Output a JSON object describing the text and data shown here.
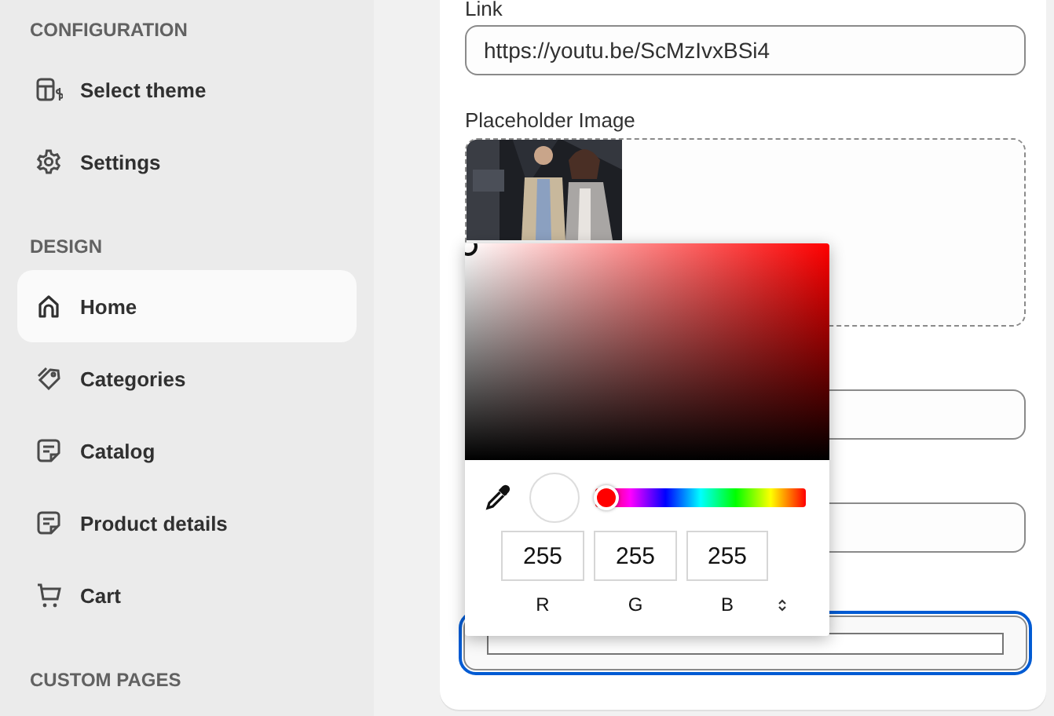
{
  "sidebar": {
    "sections": [
      {
        "title": "CONFIGURATION",
        "items": [
          {
            "label": "Select theme",
            "kind": "theme",
            "selected": false
          },
          {
            "label": "Settings",
            "kind": "gear",
            "selected": false
          }
        ]
      },
      {
        "title": "DESIGN",
        "items": [
          {
            "label": "Home",
            "kind": "home",
            "selected": true
          },
          {
            "label": "Categories",
            "kind": "tag",
            "selected": false
          },
          {
            "label": "Catalog",
            "kind": "note",
            "selected": false
          },
          {
            "label": "Product details",
            "kind": "note",
            "selected": false
          },
          {
            "label": "Cart",
            "kind": "cart",
            "selected": false
          }
        ]
      },
      {
        "title": "CUSTOM PAGES"
      }
    ]
  },
  "form": {
    "fields": [
      {
        "kind": "text",
        "label": "Link",
        "value": "https://youtu.be/ScMzIvxBSi4"
      },
      {
        "label": "Placeholder Image"
      },
      {
        "kind": "text"
      },
      {
        "kind": "text"
      },
      {
        "kind": "color",
        "focused": true
      }
    ]
  },
  "color_picker": {
    "hue": {
      "level": 0
    },
    "channels": [
      {
        "label": "R",
        "value": "255"
      },
      {
        "label": "G",
        "value": "255"
      },
      {
        "label": "B",
        "value": "255"
      }
    ]
  }
}
